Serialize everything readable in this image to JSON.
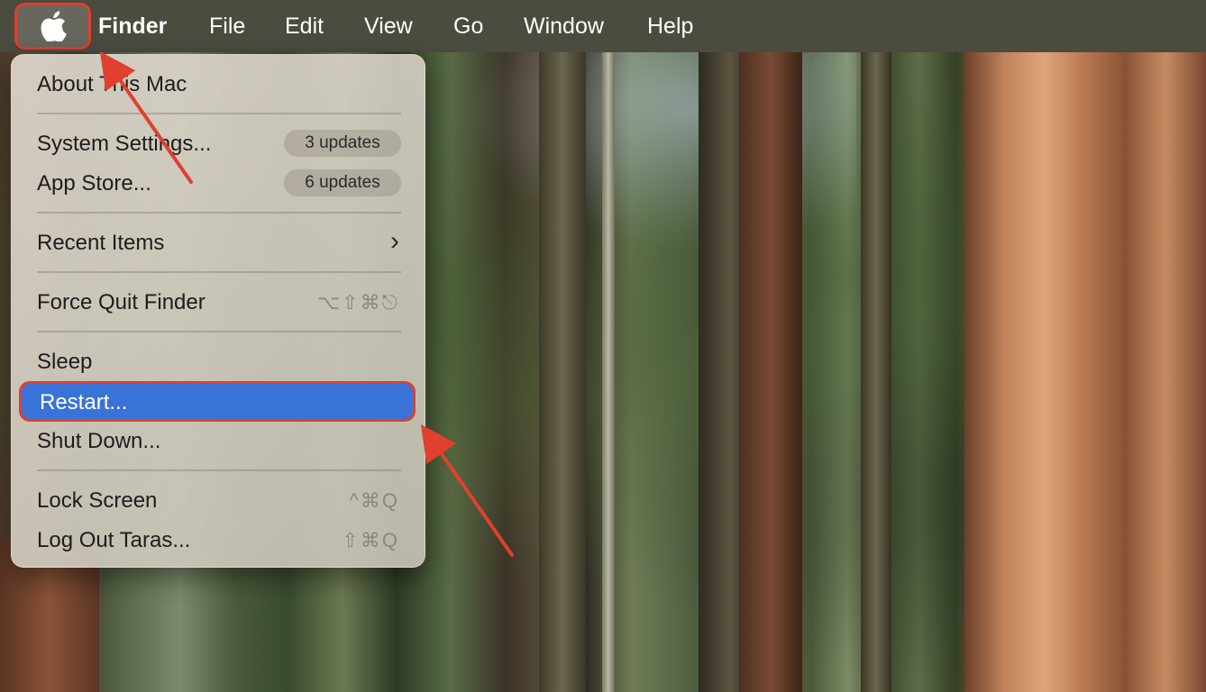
{
  "menubar": {
    "apple_icon": "apple-logo-icon",
    "items": [
      "Finder",
      "File",
      "Edit",
      "View",
      "Go",
      "Window",
      "Help"
    ]
  },
  "apple_menu": {
    "about": "About This Mac",
    "system_settings": {
      "label": "System Settings...",
      "badge": "3 updates"
    },
    "app_store": {
      "label": "App Store...",
      "badge": "6 updates"
    },
    "recent_items": {
      "label": "Recent Items",
      "chevron": "›"
    },
    "force_quit": {
      "label": "Force Quit Finder",
      "shortcut": "⌥⇧⌘⎋"
    },
    "sleep": "Sleep",
    "restart": "Restart...",
    "shut_down": "Shut Down...",
    "lock_screen": {
      "label": "Lock Screen",
      "shortcut": "^⌘Q"
    },
    "log_out": {
      "label": "Log Out Taras...",
      "shortcut": "⇧⌘Q"
    }
  },
  "colors": {
    "menubar_bg": "#4b4b40",
    "highlight_blue": "#3a73d8",
    "annotation_red": "#e0402e"
  }
}
